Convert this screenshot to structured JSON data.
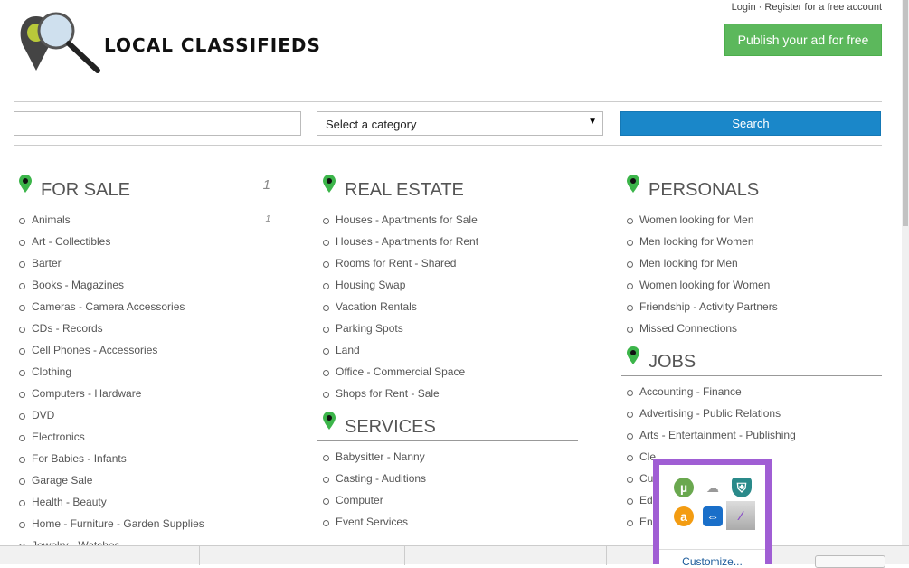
{
  "header": {
    "login": "Login",
    "separator": " · ",
    "register": "Register for a free account",
    "publish": "Publish your ad for free",
    "logo_text": "LOCAL CLASSIFIEDS"
  },
  "search": {
    "query": "",
    "category": "Select a category",
    "button": "Search"
  },
  "columns": [
    {
      "sections": [
        {
          "title": "FOR SALE",
          "count": "1",
          "items": [
            {
              "label": "Animals",
              "count": "1"
            },
            {
              "label": "Art - Collectibles"
            },
            {
              "label": "Barter"
            },
            {
              "label": "Books - Magazines"
            },
            {
              "label": "Cameras - Camera Accessories"
            },
            {
              "label": "CDs - Records"
            },
            {
              "label": "Cell Phones - Accessories"
            },
            {
              "label": "Clothing"
            },
            {
              "label": "Computers - Hardware"
            },
            {
              "label": "DVD"
            },
            {
              "label": "Electronics"
            },
            {
              "label": "For Babies - Infants"
            },
            {
              "label": "Garage Sale"
            },
            {
              "label": "Health - Beauty"
            },
            {
              "label": "Home - Furniture - Garden Supplies"
            },
            {
              "label": "Jewelry - Watches"
            }
          ]
        }
      ]
    },
    {
      "sections": [
        {
          "title": "REAL ESTATE",
          "items": [
            {
              "label": "Houses - Apartments for Sale"
            },
            {
              "label": "Houses - Apartments for Rent"
            },
            {
              "label": "Rooms for Rent - Shared"
            },
            {
              "label": "Housing Swap"
            },
            {
              "label": "Vacation Rentals"
            },
            {
              "label": "Parking Spots"
            },
            {
              "label": "Land"
            },
            {
              "label": "Office - Commercial Space"
            },
            {
              "label": "Shops for Rent - Sale"
            }
          ]
        },
        {
          "title": "SERVICES",
          "items": [
            {
              "label": "Babysitter - Nanny"
            },
            {
              "label": "Casting - Auditions"
            },
            {
              "label": "Computer"
            },
            {
              "label": "Event Services"
            }
          ]
        }
      ]
    },
    {
      "sections": [
        {
          "title": "PERSONALS",
          "items": [
            {
              "label": "Women looking for Men"
            },
            {
              "label": "Men looking for Women"
            },
            {
              "label": "Men looking for Men"
            },
            {
              "label": "Women looking for Women"
            },
            {
              "label": "Friendship - Activity Partners"
            },
            {
              "label": "Missed Connections"
            }
          ]
        },
        {
          "title": "JOBS",
          "items": [
            {
              "label": "Accounting - Finance"
            },
            {
              "label": "Advertising - Public Relations"
            },
            {
              "label": "Arts - Entertainment - Publishing"
            },
            {
              "label": "Cle"
            },
            {
              "label": "Cu"
            },
            {
              "label": "Ed"
            },
            {
              "label": "En"
            }
          ]
        }
      ]
    }
  ],
  "tray": {
    "customize": "Customize...",
    "icons": [
      "utorrent-icon",
      "cloud-icon",
      "shield-icon",
      "avast-icon",
      "teamviewer-icon",
      "pen-icon"
    ],
    "border_color": "#a05ed4"
  },
  "colors": {
    "accent": "#1a87c9",
    "publish": "#5cb85c",
    "pin": "#3cb54a"
  }
}
